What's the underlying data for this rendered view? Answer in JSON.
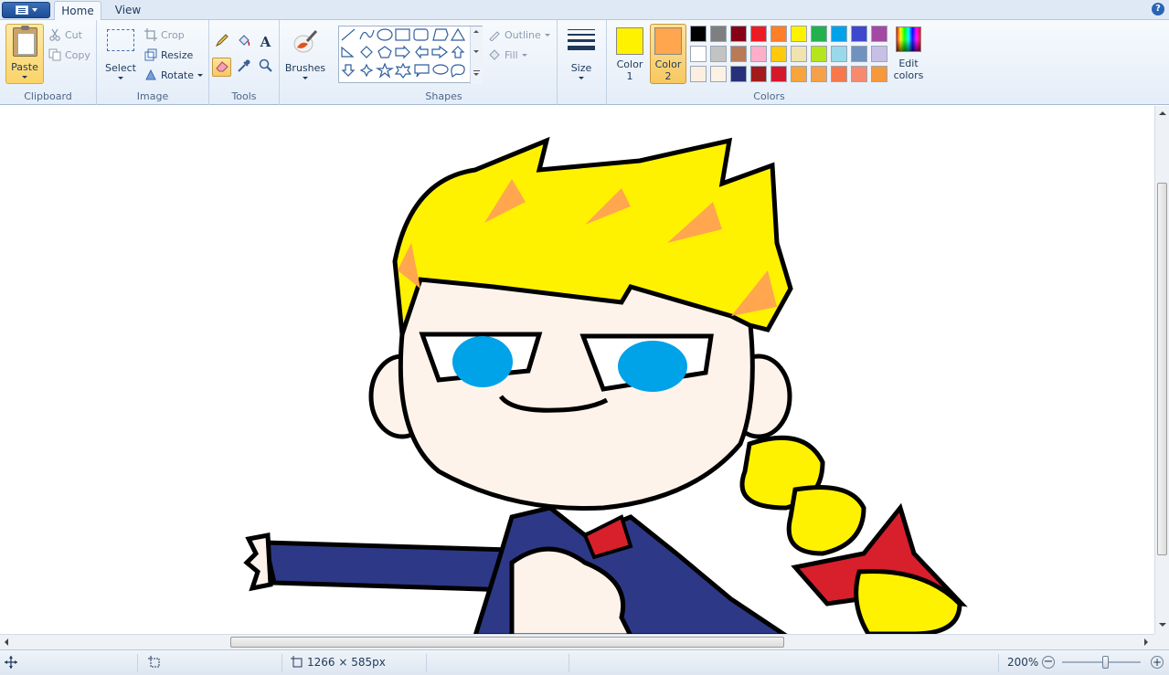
{
  "tabs": {
    "home": "Home",
    "view": "View"
  },
  "help": "?",
  "clipboard": {
    "paste": "Paste",
    "cut": "Cut",
    "copy": "Copy",
    "group": "Clipboard"
  },
  "image": {
    "select": "Select",
    "crop": "Crop",
    "resize": "Resize",
    "rotate": "Rotate",
    "group": "Image"
  },
  "tools": {
    "group": "Tools",
    "text_glyph": "A"
  },
  "brushes": {
    "label": "Brushes"
  },
  "shapes": {
    "outline": "Outline",
    "fill": "Fill",
    "group": "Shapes"
  },
  "size": {
    "label": "Size"
  },
  "colors": {
    "color1_label": "Color",
    "color1_num": "1",
    "color2_label": "Color",
    "color2_num": "2",
    "color1": "#fff200",
    "color2": "#ffa64f",
    "edit_label": "Edit",
    "edit_label2": "colors",
    "group": "Colors",
    "palette": [
      [
        "#000000",
        "#7f7f7f",
        "#880015",
        "#ed1c24",
        "#ff7f27",
        "#fff200",
        "#22b14c",
        "#00a2e8",
        "#3f48cc",
        "#a349a4"
      ],
      [
        "#ffffff",
        "#c3c3c3",
        "#b97a57",
        "#ffaec9",
        "#ffc90e",
        "#efe4b0",
        "#b5e61d",
        "#99d9ea",
        "#7092be",
        "#c8bfe7"
      ],
      [
        "#fdefe0",
        "#fdf1e4",
        "#27307a",
        "#a31a1a",
        "#d6182c",
        "#f8a33c",
        "#f7a04a",
        "#f7784a",
        "#f78a6e",
        "#f7983a"
      ]
    ]
  },
  "status": {
    "canvas_size": "1266 × 585px",
    "zoom": "200%"
  },
  "drawing": {
    "skin": "#fdf3ea",
    "hair": "#fff200",
    "hair_shade": "#ffa64f",
    "eye": "#00a2e8",
    "jacket": "#2d3987",
    "bow": "#d81f2c",
    "outline": "#000000"
  }
}
